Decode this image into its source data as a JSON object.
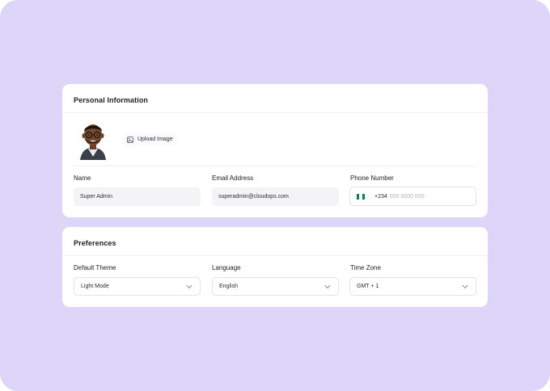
{
  "personal": {
    "title": "Personal Information",
    "upload_label": "Upload Image",
    "fields": {
      "name": {
        "label": "Name",
        "value": "Super Admin"
      },
      "email": {
        "label": "Email Address",
        "value": "superadmin@cloudops.com"
      },
      "phone": {
        "label": "Phone Number",
        "code": "+234",
        "placeholder": "000 0000 000"
      }
    }
  },
  "preferences": {
    "title": "Preferences",
    "fields": {
      "theme": {
        "label": "Default Theme",
        "value": "Light Mode"
      },
      "language": {
        "label": "Language",
        "value": "English"
      },
      "timezone": {
        "label": "Time Zone",
        "value": "GMT + 1"
      }
    }
  },
  "colors": {
    "background": "#ddd6f8",
    "card": "#ffffff",
    "flag_green": "#008751"
  },
  "icons": {
    "upload": "image-upload-icon",
    "chevron": "chevron-down-icon",
    "flag": "nigeria-flag-icon"
  }
}
